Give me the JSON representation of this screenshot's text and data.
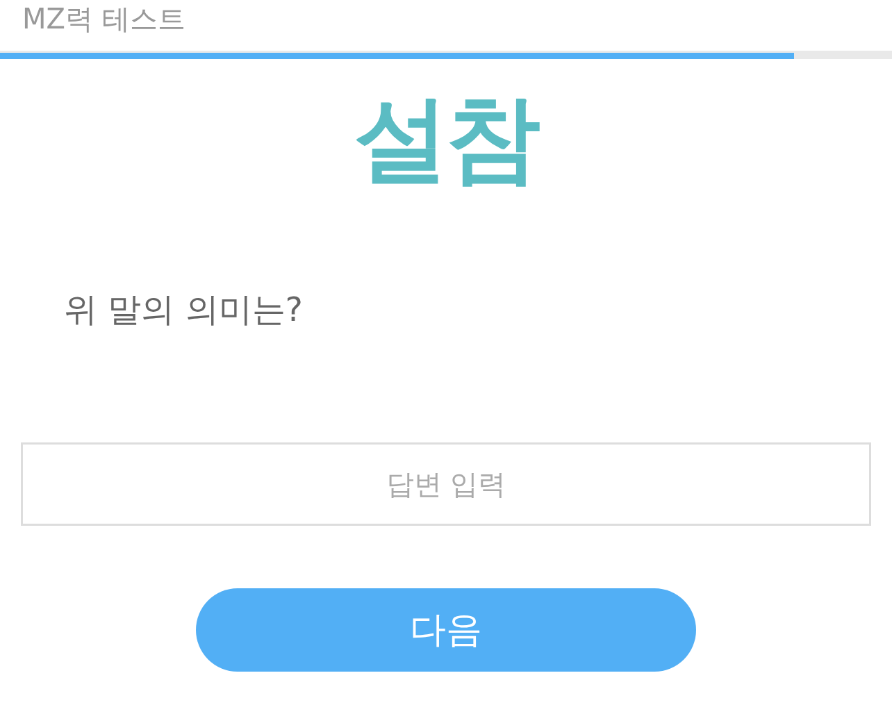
{
  "header": {
    "title": "MZ력 테스트"
  },
  "progress": {
    "level": 0.89
  },
  "quiz_word": {
    "text": "설참"
  },
  "question": {
    "text": "위 말의 의미는?"
  },
  "answer_field": {
    "placeholder": "답변 입력"
  },
  "next_button": {
    "label": "다음"
  }
}
